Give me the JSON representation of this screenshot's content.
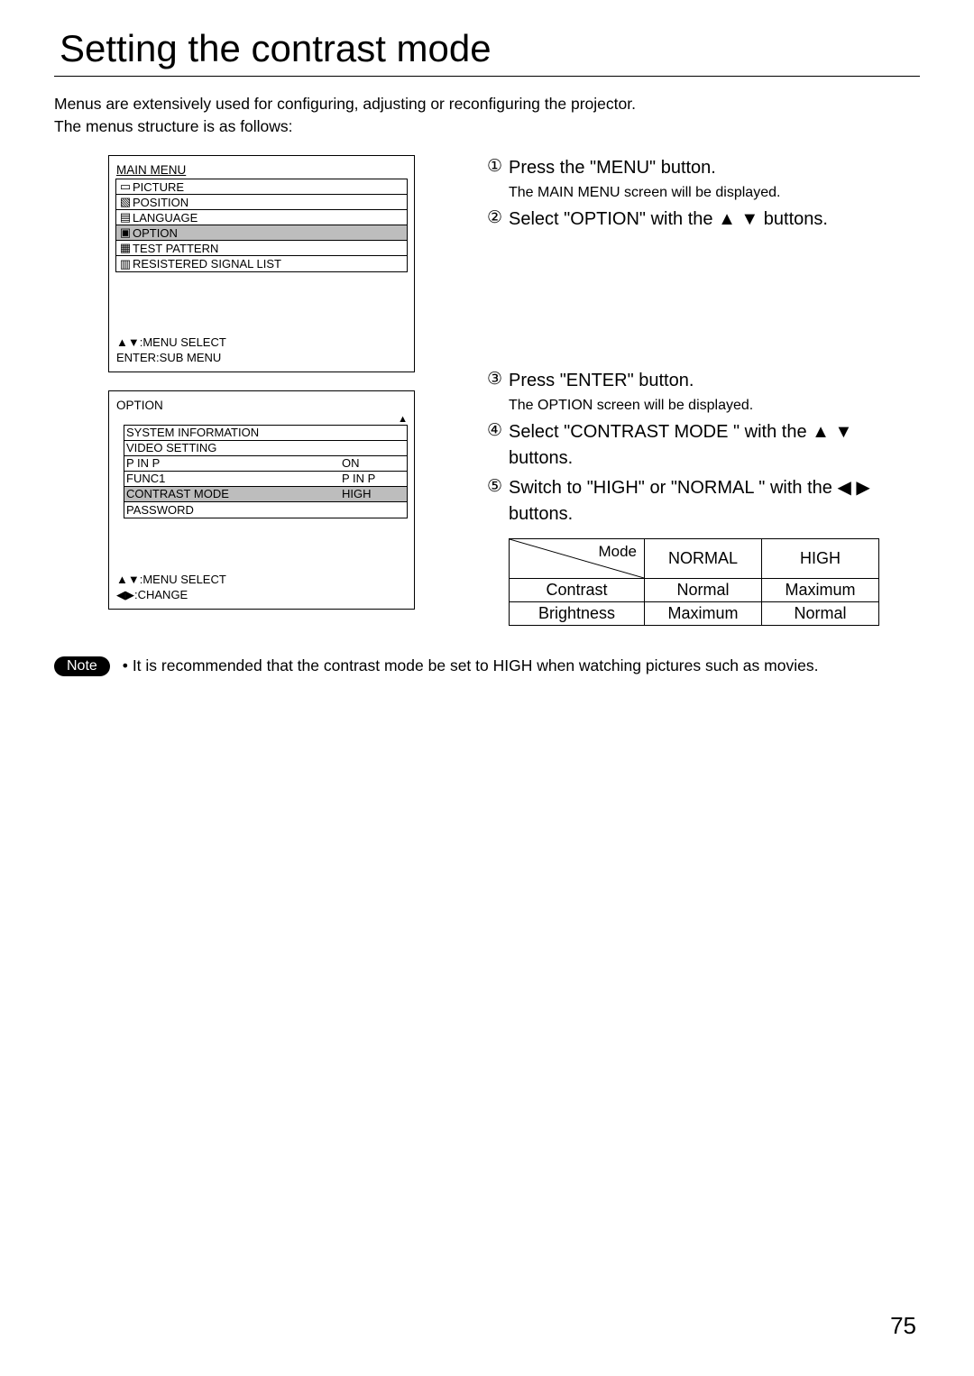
{
  "title": "Setting the contrast mode",
  "intro_line1": "Menus are extensively used for configuring, adjusting or reconfiguring the projector.",
  "intro_line2": "The menus structure is as follows:",
  "main_menu": {
    "heading": "MAIN MENU",
    "items": {
      "picture": "PICTURE",
      "position": "POSITION",
      "language": "LANGUAGE",
      "option": "OPTION",
      "test_pattern": "TEST PATTERN",
      "signal_list": "RESISTERED SIGNAL LIST"
    },
    "footer1": "▲▼:MENU SELECT",
    "footer2": "ENTER:SUB MENU"
  },
  "option_menu": {
    "heading": "OPTION",
    "items": {
      "sysinfo": "SYSTEM INFORMATION",
      "video": "VIDEO SETTING",
      "pinp": {
        "label": "P IN P",
        "val": "ON"
      },
      "func1": {
        "label": "FUNC1",
        "val": "P IN P"
      },
      "contrast": {
        "label": "CONTRAST MODE",
        "val": "HIGH"
      },
      "password": "PASSWORD"
    },
    "footer1": "▲▼:MENU SELECT",
    "footer2": "◀▶:CHANGE"
  },
  "steps": {
    "s1": {
      "num": "①",
      "text_a": "Press the  ",
      "key": "\"MENU\"",
      "text_b": " button.",
      "sub": "The MAIN MENU screen will be displayed."
    },
    "s2": {
      "num": "②",
      "text_a": "Select ",
      "key": "\"OPTION\"",
      "text_b": " with the  ▲ ▼ buttons."
    },
    "s3": {
      "num": "③",
      "text_a": "Press  ",
      "key": "\"ENTER\"",
      "text_b": " button.",
      "sub": "The OPTION screen will be displayed."
    },
    "s4": {
      "num": "④",
      "text_a": "Select ",
      "key": "\"CONTRAST MODE ",
      "text_b": "\" with the ▲ ▼  buttons."
    },
    "s5": {
      "num": "⑤",
      "text_a": "Switch to  ",
      "key1": "\"HIGH\"",
      "mid": " or ",
      "key2": "\"NORMAL \"",
      "text_b": " with the  ◀  ▶ buttons."
    }
  },
  "table": {
    "diag_label": "Mode",
    "col_normal": "NORMAL",
    "col_high": "HIGH",
    "row_contrast": {
      "label": "Contrast",
      "normal": "Normal",
      "high": "Maximum"
    },
    "row_brightness": {
      "label": "Brightness",
      "normal": "Maximum",
      "high": "Normal"
    }
  },
  "note": {
    "pill": "Note",
    "bullet": "•",
    "text": "It is recommended that the contrast mode be set to  HIGH  when watching pictures such as movies."
  },
  "page_number": "75"
}
